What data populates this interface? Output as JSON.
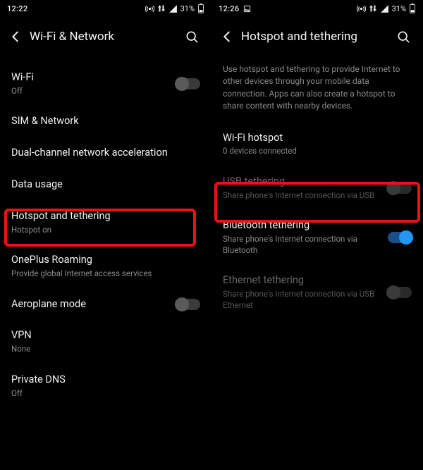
{
  "left": {
    "status": {
      "time": "12:22",
      "battery": "31%"
    },
    "title": "Wi-Fi & Network",
    "rows": {
      "wifi": {
        "title": "Wi-Fi",
        "sub": "Off",
        "toggle": "off"
      },
      "sim": {
        "title": "SIM & Network"
      },
      "dual": {
        "title": "Dual-channel network acceleration"
      },
      "data": {
        "title": "Data usage"
      },
      "hotspot": {
        "title": "Hotspot and tethering",
        "sub": "Hotspot on"
      },
      "roaming": {
        "title": "OnePlus Roaming",
        "sub": "Provide global Internet access services"
      },
      "airplane": {
        "title": "Aeroplane mode",
        "toggle": "off"
      },
      "vpn": {
        "title": "VPN",
        "sub": "None"
      },
      "dns": {
        "title": "Private DNS",
        "sub": "Off"
      }
    }
  },
  "right": {
    "status": {
      "time": "12:26",
      "battery": "31%"
    },
    "title": "Hotspot and tethering",
    "description": "Use hotspot and tethering to provide Internet to other devices through your mobile data connection. Apps can also create a hotspot to share content with nearby devices.",
    "rows": {
      "wifihs": {
        "title": "Wi-Fi hotspot",
        "sub": "0 devices connected"
      },
      "usb": {
        "title": "USB tethering",
        "sub": "Share phone's Internet connection via USB",
        "toggle": "off",
        "disabled": true
      },
      "bt": {
        "title": "Bluetooth tethering",
        "sub": "Share phone's Internet connection via Bluetooth",
        "toggle": "on"
      },
      "eth": {
        "title": "Ethernet tethering",
        "sub": "Share phone's Internet connection via USB Ethernet",
        "toggle": "off",
        "disabled": true
      }
    }
  }
}
